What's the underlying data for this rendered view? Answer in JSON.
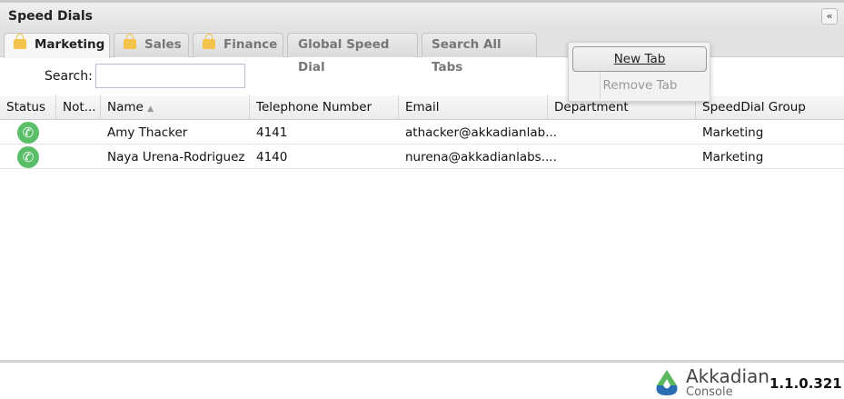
{
  "panel": {
    "title": "Speed Dials",
    "collapse_icon": "«"
  },
  "tabs": [
    {
      "label": "Marketing",
      "locked": true,
      "active": true
    },
    {
      "label": "Sales",
      "locked": true
    },
    {
      "label": "Finance",
      "locked": true
    },
    {
      "label": "Global Speed Dial",
      "locked": false
    },
    {
      "label": "Search All Tabs",
      "locked": false
    }
  ],
  "search": {
    "label": "Search:",
    "value": "",
    "placeholder": ""
  },
  "columns": [
    "Status",
    "Not...",
    "Name",
    "Telephone Number",
    "Email",
    "Department",
    "SpeedDial Group"
  ],
  "rows": [
    {
      "name": "Amy Thacker",
      "phone": "4141",
      "email": "athacker@akkadianlab...",
      "department": "",
      "group": "Marketing"
    },
    {
      "name": "Naya Urena-Rodriguez",
      "phone": "4140",
      "email": "nurena@akkadianlabs....",
      "department": "",
      "group": "Marketing"
    }
  ],
  "context_menu": {
    "new_tab": "New Tab",
    "remove_tab": "Remove Tab"
  },
  "footer": {
    "brand": "Akkadian",
    "product": "Console",
    "version": "1.1.0.321"
  }
}
